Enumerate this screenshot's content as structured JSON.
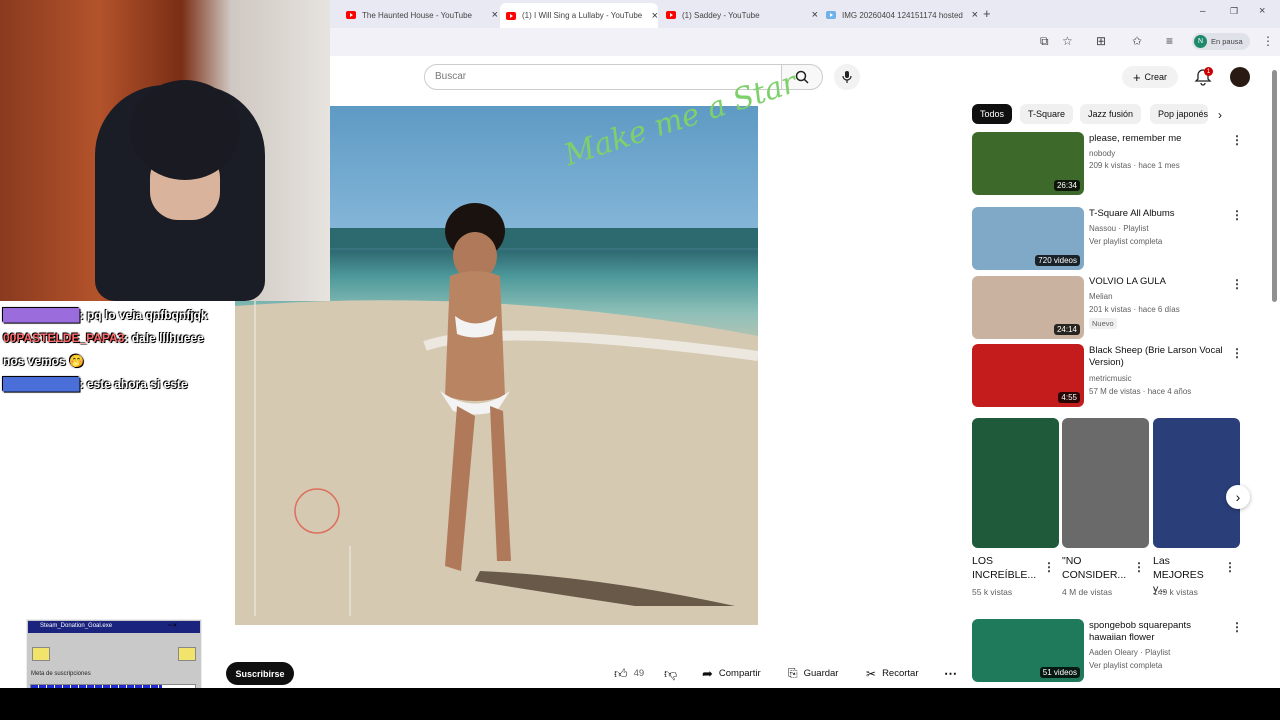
{
  "browser": {
    "tabs": [
      {
        "title": "The Haunted House - YouTube",
        "type": "youtube"
      },
      {
        "title": "(1) I Will Sing a Lullaby - YouTube",
        "type": "youtube",
        "active": true
      },
      {
        "title": "(1) Saddey - YouTube",
        "type": "youtube"
      },
      {
        "title": "IMG 20260404 124151174 hosted",
        "type": "image"
      }
    ],
    "profile_initial": "N",
    "profile_status": "En pausa"
  },
  "header": {
    "search_placeholder": "Buscar",
    "create_label": "Crear",
    "notification_count": "1"
  },
  "stream_overlay": {
    "chat": [
      {
        "user": "█████████",
        "message": "pq lo veia qnfbqnfjqk",
        "user_color": "#9b6ddc"
      },
      {
        "user": "00PASTELDE_PAPA3",
        "message": "dale lllhueee",
        "user_color": "#ff6b6b"
      },
      {
        "user": "",
        "message": "nos vemos 🤭",
        "user_color": "#ffffff"
      },
      {
        "user": "█████████",
        "message": "este ahora si este",
        "user_color": "#4a6fd8"
      }
    ],
    "widget": {
      "title": "Steam_Donation_Goal.exe",
      "label": "Meta de suscripciones",
      "progress": 0.8
    }
  },
  "video": {
    "album_script": "Make me a Star",
    "subscribe_label": "Suscribirse",
    "likes": "49",
    "share_label": "Compartir",
    "save_label": "Guardar",
    "clip_label": "Recortar"
  },
  "chips": [
    "Todos",
    "T-Square",
    "Jazz fusión",
    "Pop japonés"
  ],
  "recommendations": [
    {
      "title": "please, remember me",
      "channel": "nobody",
      "verified": true,
      "meta": "209 k vistas · hace 1 mes",
      "duration": "26:34",
      "thumb_color": "#3d6a2a"
    },
    {
      "title": "T-Square All Albums",
      "channel": "Nassou · Playlist",
      "meta": "Ver playlist completa",
      "duration": "720 videos",
      "thumb_color": "#7fa9c6"
    },
    {
      "title": "VOLVIO LA GULA",
      "channel": "Melian",
      "meta": "201 k vistas · hace 6 días",
      "badge": "Nuevo",
      "duration": "24:14",
      "thumb_color": "#c9b3a0"
    },
    {
      "title": "Black Sheep (Brie Larson Vocal Version)",
      "channel": "metricmusic",
      "verified": true,
      "meta": "57 M de vistas · hace 4 años",
      "duration": "4:55",
      "thumb_color": "#c41c1c"
    },
    {
      "title": "spongebob squarepants hawaiian flower",
      "channel": "Aaden Oleary · Playlist",
      "meta": "Ver playlist completa",
      "duration": "51 videos",
      "thumb_color": "#1e7a5a"
    }
  ],
  "shorts": [
    {
      "title": "LOS INCREÍBLE...",
      "views": "55 k vistas",
      "thumb_color": "#1f5a3a"
    },
    {
      "title": "\"NO CONSIDER...",
      "views": "4 M de vistas",
      "thumb_color": "#6a6a6a"
    },
    {
      "title": "Las MEJORES y...",
      "views": "149 k vistas",
      "thumb_color": "#2a3f7a"
    }
  ]
}
